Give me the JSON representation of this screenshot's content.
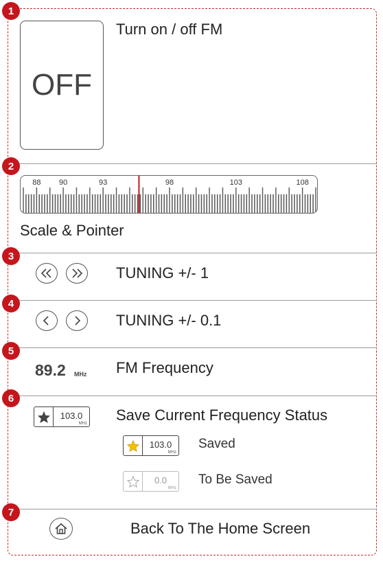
{
  "sections": [
    {
      "number": "1",
      "label": "Turn on / off FM"
    },
    {
      "number": "2",
      "label": "Scale & Pointer"
    },
    {
      "number": "3",
      "label": "TUNING +/- 1"
    },
    {
      "number": "4",
      "label": "TUNING +/- 0.1"
    },
    {
      "number": "5",
      "label": "FM Frequency"
    },
    {
      "number": "6",
      "label": "Save Current Frequency Status"
    },
    {
      "number": "7",
      "label": "Back To The Home Screen"
    }
  ],
  "power_button": {
    "text": "OFF"
  },
  "scale": {
    "tick_labels": [
      "88",
      "90",
      "93",
      "98",
      "103",
      "108"
    ],
    "tick_label_values": [
      88,
      90,
      93,
      98,
      103,
      108
    ],
    "min": 87,
    "max": 109,
    "pointer_value": 95.7,
    "pointer_color": "#c4161c"
  },
  "frequency": {
    "value": "89.2",
    "unit": "MHz"
  },
  "save_chip": {
    "value": "103.0",
    "unit": "MHz"
  },
  "saved_state": {
    "value": "103.0",
    "unit": "MHz",
    "label": "Saved",
    "star_color": "#f5c000"
  },
  "to_be_saved_state": {
    "value": "0.0",
    "unit": "MHz",
    "label": "To Be Saved"
  },
  "colors": {
    "accent": "#c4161c"
  }
}
